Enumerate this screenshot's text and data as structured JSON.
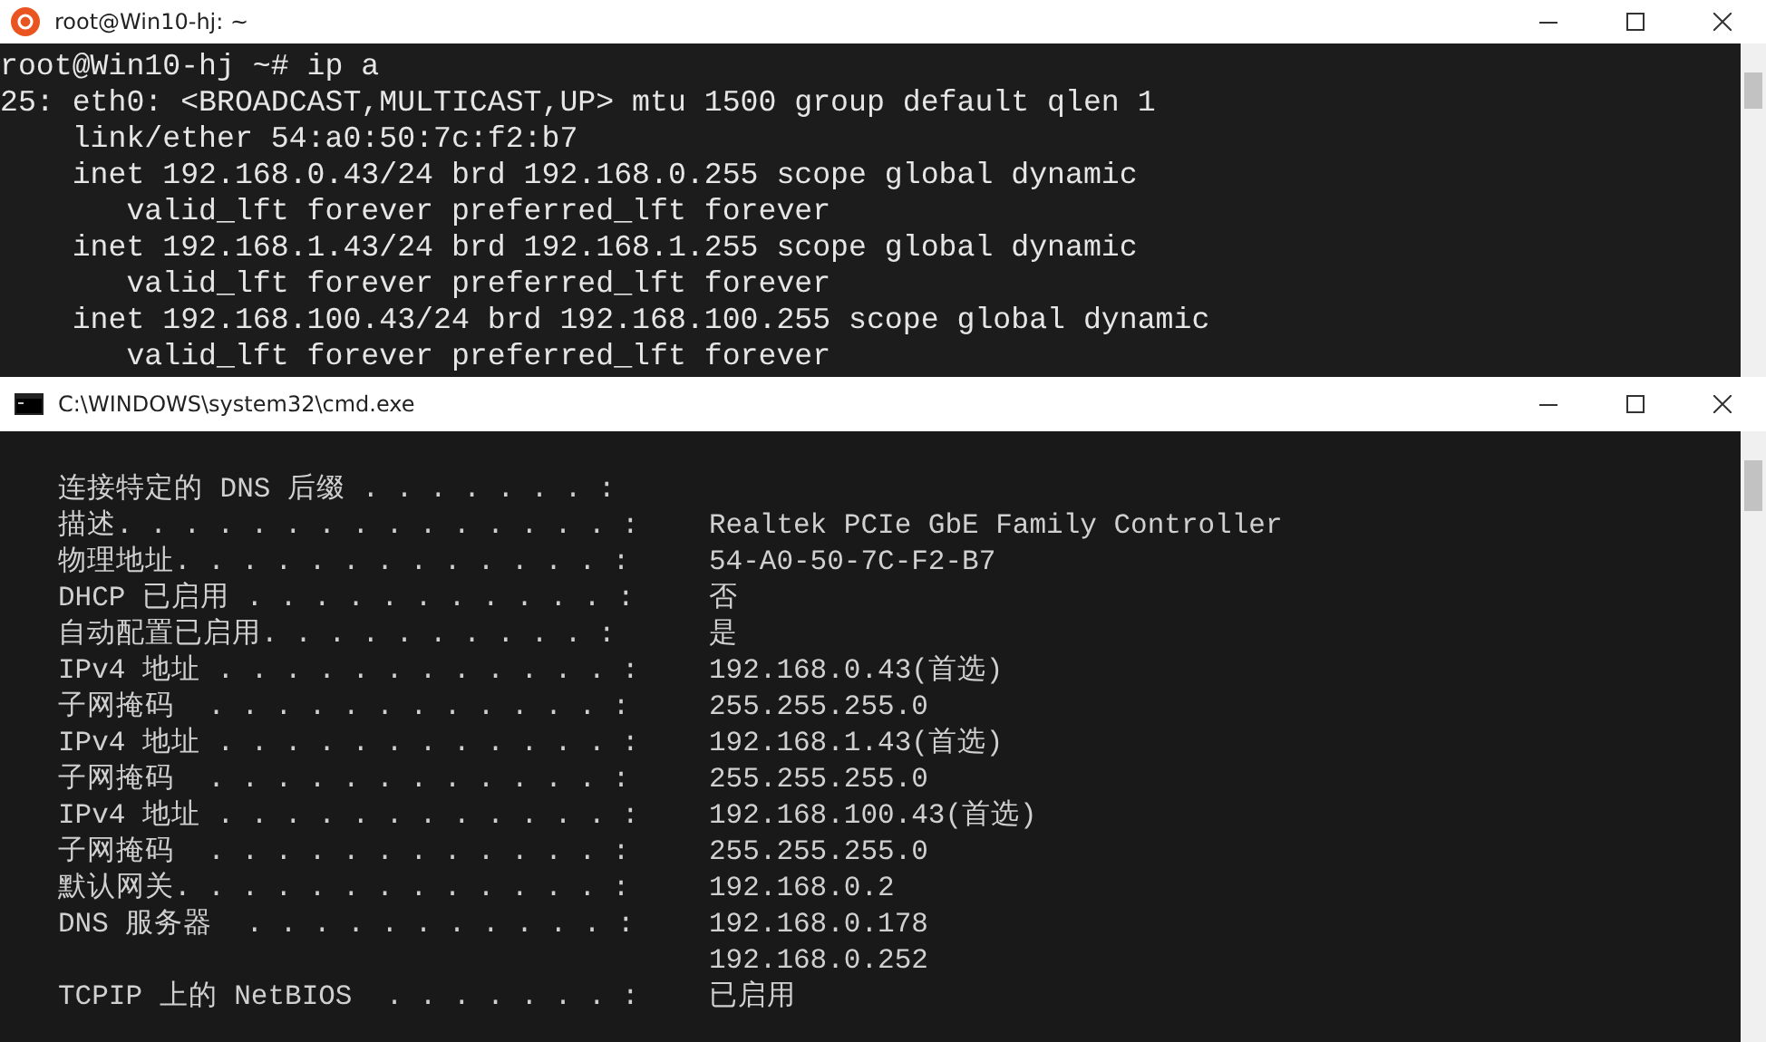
{
  "bash_window": {
    "title": "root@Win10-hj: ~",
    "lines": [
      "root@Win10-hj ~# ip a",
      "25: eth0: <BROADCAST,MULTICAST,UP> mtu 1500 group default qlen 1",
      "    link/ether 54:a0:50:7c:f2:b7",
      "    inet 192.168.0.43/24 brd 192.168.0.255 scope global dynamic",
      "       valid_lft forever preferred_lft forever",
      "    inet 192.168.1.43/24 brd 192.168.1.255 scope global dynamic",
      "       valid_lft forever preferred_lft forever",
      "    inet 192.168.100.43/24 brd 192.168.100.255 scope global dynamic",
      "       valid_lft forever preferred_lft forever"
    ]
  },
  "cmd_window": {
    "title": "C:\\WINDOWS\\system32\\cmd.exe",
    "rows": [
      {
        "label": "连接特定的 DNS 后缀 . . . . . . . :",
        "value": ""
      },
      {
        "label": "描述. . . . . . . . . . . . . . . :",
        "value": "Realtek PCIe GbE Family Controller"
      },
      {
        "label": "物理地址. . . . . . . . . . . . . :",
        "value": "54-A0-50-7C-F2-B7"
      },
      {
        "label": "DHCP 已启用 . . . . . . . . . . . :",
        "value": "否"
      },
      {
        "label": "自动配置已启用. . . . . . . . . . :",
        "value": "是"
      },
      {
        "label": "IPv4 地址 . . . . . . . . . . . . :",
        "value": "192.168.0.43(首选)"
      },
      {
        "label": "子网掩码  . . . . . . . . . . . . :",
        "value": "255.255.255.0"
      },
      {
        "label": "IPv4 地址 . . . . . . . . . . . . :",
        "value": "192.168.1.43(首选)"
      },
      {
        "label": "子网掩码  . . . . . . . . . . . . :",
        "value": "255.255.255.0"
      },
      {
        "label": "IPv4 地址 . . . . . . . . . . . . :",
        "value": "192.168.100.43(首选)"
      },
      {
        "label": "子网掩码  . . . . . . . . . . . . :",
        "value": "255.255.255.0"
      },
      {
        "label": "默认网关. . . . . . . . . . . . . :",
        "value": "192.168.0.2"
      },
      {
        "label": "DNS 服务器  . . . . . . . . . . . :",
        "value": "192.168.0.178"
      },
      {
        "label": "",
        "value": "192.168.0.252"
      },
      {
        "label": "TCPIP 上的 NetBIOS  . . . . . . . :",
        "value": "已启用"
      }
    ]
  }
}
